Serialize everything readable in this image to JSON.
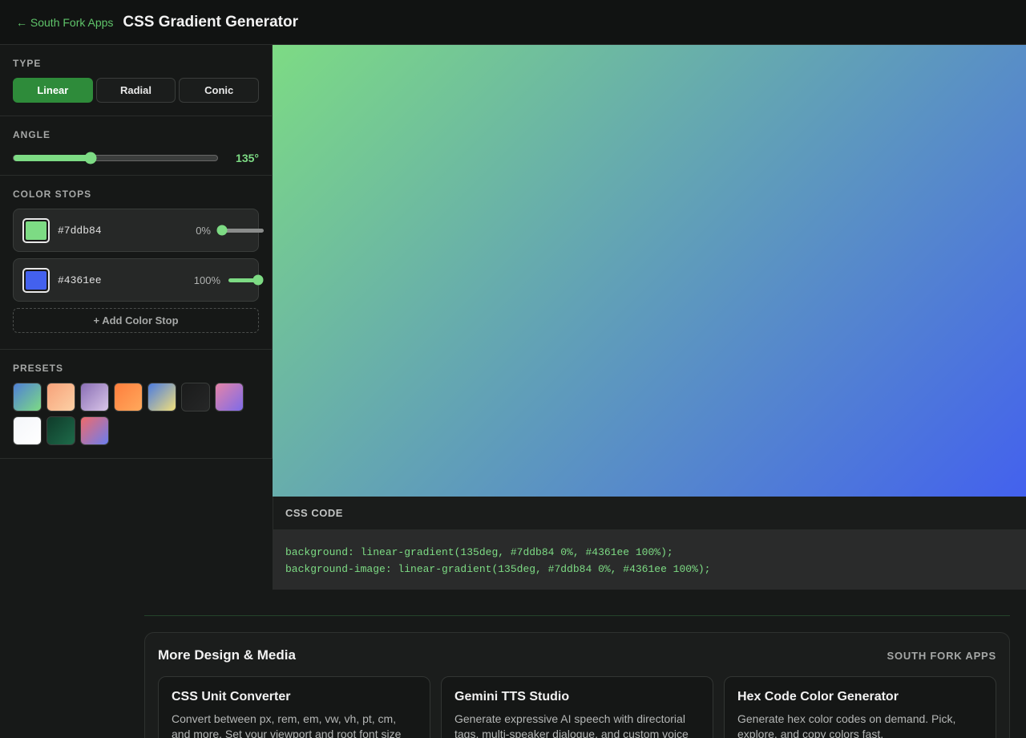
{
  "header": {
    "back_label": "← South Fork Apps",
    "title": "CSS Gradient Generator"
  },
  "type_section": {
    "label": "TYPE",
    "options": [
      "Linear",
      "Radial",
      "Conic"
    ],
    "selected": "Linear"
  },
  "angle_section": {
    "label": "ANGLE",
    "value_label": "135°",
    "value": 135,
    "max": 360
  },
  "stops_section": {
    "label": "COLOR STOPS",
    "stops": [
      {
        "hex": "#7ddb84",
        "percent_label": "0%",
        "percent": 0
      },
      {
        "hex": "#4361ee",
        "percent_label": "100%",
        "percent": 100
      }
    ],
    "add_label": "+ Add Color Stop"
  },
  "presets_section": {
    "label": "PRESETS",
    "presets": [
      {
        "from": "#4f7fd6",
        "to": "#7ddb84"
      },
      {
        "from": "#f7a27a",
        "to": "#fcd0a5"
      },
      {
        "from": "#8a6fb5",
        "to": "#d9c5e8"
      },
      {
        "from": "#ff7e3d",
        "to": "#ffa95c"
      },
      {
        "from": "#4b7be0",
        "to": "#f2e07a"
      },
      {
        "from": "#1a1b1b",
        "to": "#262727"
      },
      {
        "from": "#e584a8",
        "to": "#7e6be8"
      },
      {
        "from": "#f4f6fa",
        "to": "#ffffff"
      },
      {
        "from": "#0f3b2a",
        "to": "#1e6b4a"
      },
      {
        "from": "#f06a6a",
        "to": "#6b7ef0"
      }
    ]
  },
  "code_panel": {
    "label": "CSS CODE",
    "line1": "background: linear-gradient(135deg, #7ddb84 0%, #4361ee 100%);",
    "line2": "background-image: linear-gradient(135deg, #7ddb84 0%, #4361ee 100%);"
  },
  "more_section": {
    "title": "More Design & Media",
    "brand": "SOUTH FORK APPS",
    "cards": [
      {
        "title": "CSS Unit Converter",
        "desc": "Convert between px, rem, em, vw, vh, pt, cm, and more. Set your viewport and root font size"
      },
      {
        "title": "Gemini TTS Studio",
        "desc": "Generate expressive AI speech with directorial tags, multi-speaker dialogue, and custom voice"
      },
      {
        "title": "Hex Code Color Generator",
        "desc": "Generate hex color codes on demand. Pick, explore, and copy colors fast."
      }
    ]
  },
  "colors": {
    "accent": "#7ddb84",
    "button_active": "#2e8b3a",
    "gradient_start": "#7ddb84",
    "gradient_end": "#4361ee"
  }
}
